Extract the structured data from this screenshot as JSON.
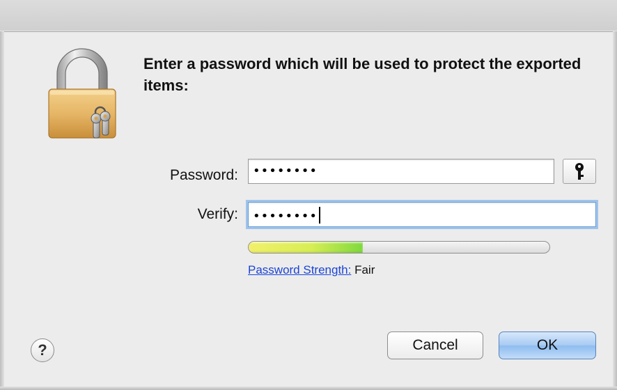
{
  "dialog": {
    "message": "Enter a password which will be used to protect the exported items:",
    "password_label": "Password:",
    "password_value": "••••••••",
    "verify_label": "Verify:",
    "verify_value": "••••••••",
    "strength_link": "Password Strength:",
    "strength_value": "Fair",
    "strength_fraction": 0.38,
    "help_label": "?",
    "cancel_label": "Cancel",
    "ok_label": "OK"
  },
  "colors": {
    "accent": "#8ebcf0",
    "link": "#1b44d6"
  },
  "icons": [
    "lock-keys-icon",
    "key-icon",
    "help-icon"
  ]
}
